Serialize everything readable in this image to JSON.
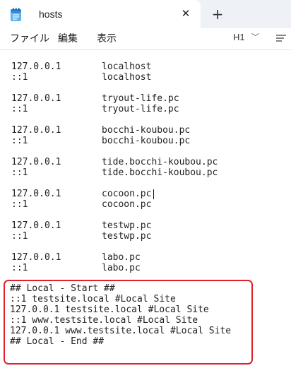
{
  "window": {
    "tab_title": "hosts",
    "close_glyph": "✕",
    "new_tab_glyph": "+"
  },
  "menu": {
    "file": "ファイル",
    "edit": "編集",
    "view": "表示",
    "heading": "H1",
    "heading_chevron": "﹀"
  },
  "hosts": [
    {
      "ip1": "127.0.0.1",
      "name1": "localhost",
      "ip2": "::1",
      "name2": "localhost"
    },
    {
      "ip1": "127.0.0.1",
      "name1": "tryout-life.pc",
      "ip2": "::1",
      "name2": "tryout-life.pc"
    },
    {
      "ip1": "127.0.0.1",
      "name1": "bocchi-koubou.pc",
      "ip2": "::1",
      "name2": "bocchi-koubou.pc"
    },
    {
      "ip1": "127.0.0.1",
      "name1": "tide.bocchi-koubou.pc",
      "ip2": "::1",
      "name2": "tide.bocchi-koubou.pc"
    },
    {
      "ip1": "127.0.0.1",
      "name1": "cocoon.pc",
      "ip2": "::1",
      "name2": "cocoon.pc"
    },
    {
      "ip1": "127.0.0.1",
      "name1": "testwp.pc",
      "ip2": "::1",
      "name2": "testwp.pc"
    },
    {
      "ip1": "127.0.0.1",
      "name1": "labo.pc",
      "ip2": "::1",
      "name2": "labo.pc"
    }
  ],
  "local_block": [
    "## Local - Start ##",
    "::1 testsite.local #Local Site",
    "127.0.0.1 testsite.local #Local Site",
    "::1 www.testsite.local #Local Site",
    "127.0.0.1 www.testsite.local #Local Site",
    "## Local - End ##"
  ],
  "colors": {
    "highlight_border": "#e0202a",
    "app_icon": "#2b88d8"
  },
  "icons": {
    "app": "notepad-icon",
    "close": "close-icon",
    "new_tab": "plus-icon",
    "format": "format-icon"
  }
}
